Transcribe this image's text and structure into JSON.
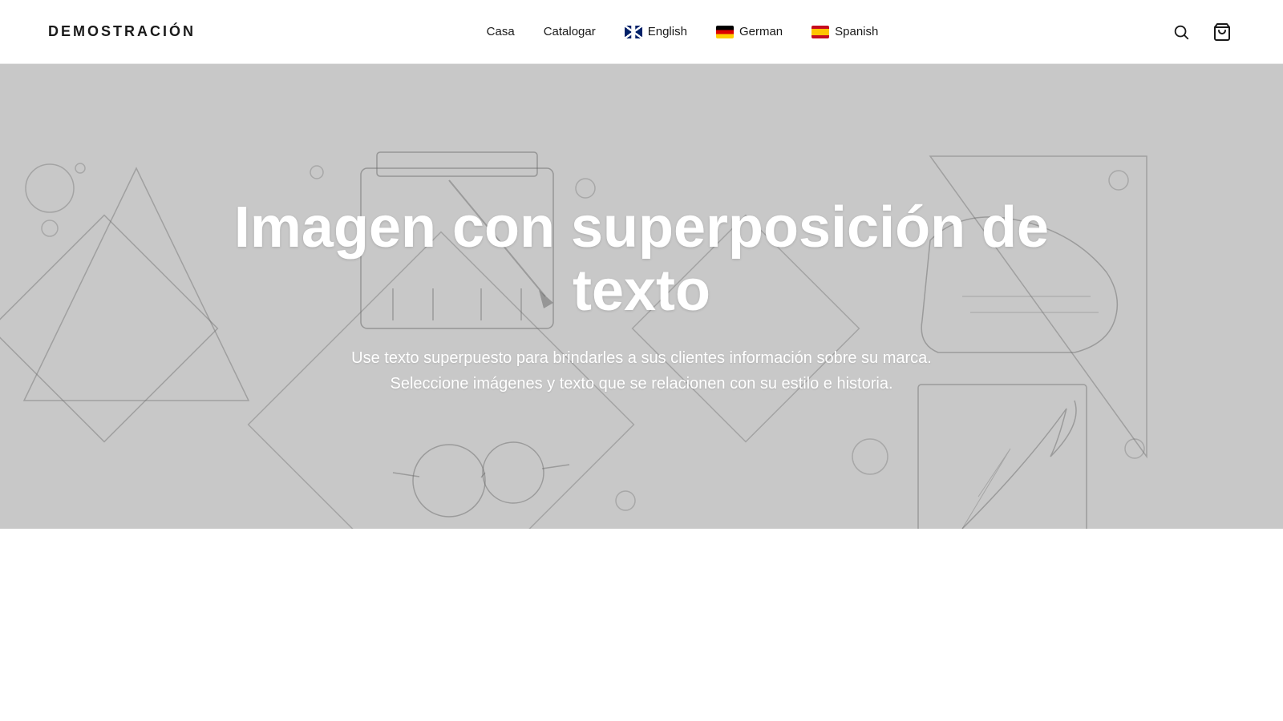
{
  "header": {
    "logo": "DEMOSTRACIÓN",
    "nav": {
      "links": [
        {
          "id": "casa",
          "label": "Casa"
        },
        {
          "id": "catalogar",
          "label": "Catalogar"
        }
      ],
      "languages": [
        {
          "id": "english",
          "label": "English",
          "flag": "uk"
        },
        {
          "id": "german",
          "label": "German",
          "flag": "de"
        },
        {
          "id": "spanish",
          "label": "Spanish",
          "flag": "es"
        }
      ]
    }
  },
  "hero": {
    "title": "Imagen con superposición de texto",
    "subtitle": "Use texto superpuesto para brindarles a sus clientes información sobre su marca. Seleccione imágenes y texto que se relacionen con su estilo e historia."
  }
}
